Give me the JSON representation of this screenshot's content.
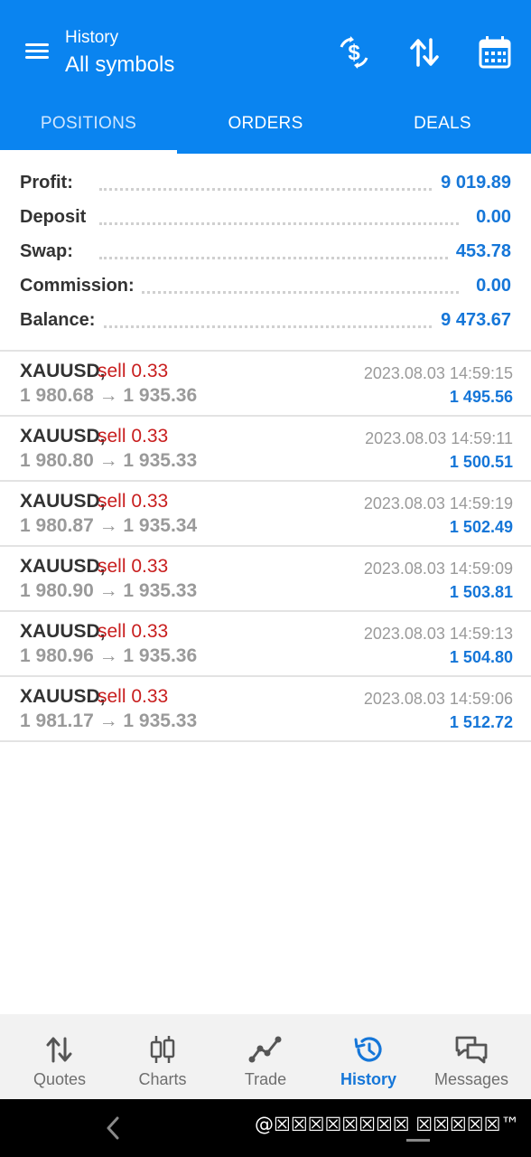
{
  "header": {
    "subtitle": "History",
    "title": "All symbols",
    "icons": [
      "currency-exchange-icon",
      "sort-icon",
      "calendar-icon"
    ]
  },
  "tabs": [
    {
      "label": "POSITIONS",
      "active": true
    },
    {
      "label": "ORDERS",
      "active": false
    },
    {
      "label": "DEALS",
      "active": false
    }
  ],
  "summary": [
    {
      "label": "Profit:",
      "value": "9 019.89"
    },
    {
      "label": "Deposit",
      "value": "0.00"
    },
    {
      "label": "Swap:",
      "value": "453.78"
    },
    {
      "label": "Commission:",
      "value": "0.00"
    },
    {
      "label": "Balance:",
      "value": "9 473.67"
    }
  ],
  "deals": [
    {
      "symbol": "XAUUSD,",
      "side": "sell 0.33",
      "prices": "1 980.68 → 1 935.36",
      "time": "2023.08.03 14:59:15",
      "profit": "1 495.56"
    },
    {
      "symbol": "XAUUSD,",
      "side": "sell 0.33",
      "prices": "1 980.80 → 1 935.33",
      "time": "2023.08.03 14:59:11",
      "profit": "1 500.51"
    },
    {
      "symbol": "XAUUSD,",
      "side": "sell 0.33",
      "prices": "1 980.87 → 1 935.34",
      "time": "2023.08.03 14:59:19",
      "profit": "1 502.49"
    },
    {
      "symbol": "XAUUSD,",
      "side": "sell 0.33",
      "prices": "1 980.90 → 1 935.33",
      "time": "2023.08.03 14:59:09",
      "profit": "1 503.81"
    },
    {
      "symbol": "XAUUSD,",
      "side": "sell 0.33",
      "prices": "1 980.96 → 1 935.36",
      "time": "2023.08.03 14:59:13",
      "profit": "1 504.80"
    },
    {
      "symbol": "XAUUSD,",
      "side": "sell 0.33",
      "prices": "1 981.17 → 1 935.33",
      "time": "2023.08.03 14:59:06",
      "profit": "1 512.72"
    }
  ],
  "bottom_nav": [
    {
      "label": "Quotes",
      "icon": "quotes-arrows-icon",
      "active": false
    },
    {
      "label": "Charts",
      "icon": "candlestick-icon",
      "active": false
    },
    {
      "label": "Trade",
      "icon": "trend-line-icon",
      "active": false
    },
    {
      "label": "History",
      "icon": "history-clock-icon",
      "active": true
    },
    {
      "label": "Messages",
      "icon": "chat-bubbles-icon",
      "active": false
    }
  ],
  "watermark": "@☒☒☒☒☒☒☒☒ ☒☒☒☒☒™",
  "colors": {
    "accent": "#0a84f0",
    "profit_blue": "#1576d8",
    "sell_red": "#c81e1e",
    "muted_gray": "#9a9a9a"
  }
}
